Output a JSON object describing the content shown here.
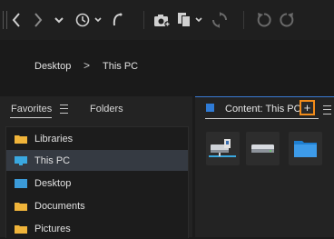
{
  "toolbar": {
    "buttons": [
      {
        "name": "back-button",
        "icon": "chevron-left-icon"
      },
      {
        "name": "forward-button",
        "icon": "chevron-right-icon"
      },
      {
        "name": "history-dropdown-button",
        "icon": "chevron-down-icon"
      },
      {
        "name": "recent-button",
        "icon": "clock-history-icon"
      },
      {
        "name": "pick-from-recent-button",
        "icon": "boomerang-icon"
      },
      {
        "name": "camera-button",
        "icon": "camera-icon"
      },
      {
        "name": "copy-button",
        "icon": "copy-icon"
      },
      {
        "name": "refresh-button",
        "icon": "refresh-icon"
      },
      {
        "name": "undo-button",
        "icon": "rotate-left-icon"
      },
      {
        "name": "redo-button",
        "icon": "rotate-right-icon"
      }
    ]
  },
  "breadcrumb": {
    "items": [
      "Desktop",
      "This PC"
    ],
    "separator": ">"
  },
  "left_panel": {
    "tabs": [
      {
        "label": "Favorites"
      },
      {
        "label": "Folders"
      }
    ],
    "favorites": [
      {
        "label": "Libraries",
        "icon": "folder-icon"
      },
      {
        "label": "This PC",
        "icon": "monitor-icon"
      },
      {
        "label": "Desktop",
        "icon": "desktop-icon"
      },
      {
        "label": "Documents",
        "icon": "folder-icon"
      },
      {
        "label": "Pictures",
        "icon": "folder-icon"
      }
    ],
    "selected": "This PC"
  },
  "content_panel": {
    "tab_label": "Content: This PC",
    "add_label": "+",
    "thumbnails": [
      {
        "icon": "network-drive-icon"
      },
      {
        "icon": "hard-drive-icon"
      },
      {
        "icon": "folder-blue-icon"
      }
    ]
  },
  "colors": {
    "accent": "#f28c1a",
    "selection": "#353a42",
    "folder": "#f0b43a",
    "blue": "#2f7bd6"
  }
}
